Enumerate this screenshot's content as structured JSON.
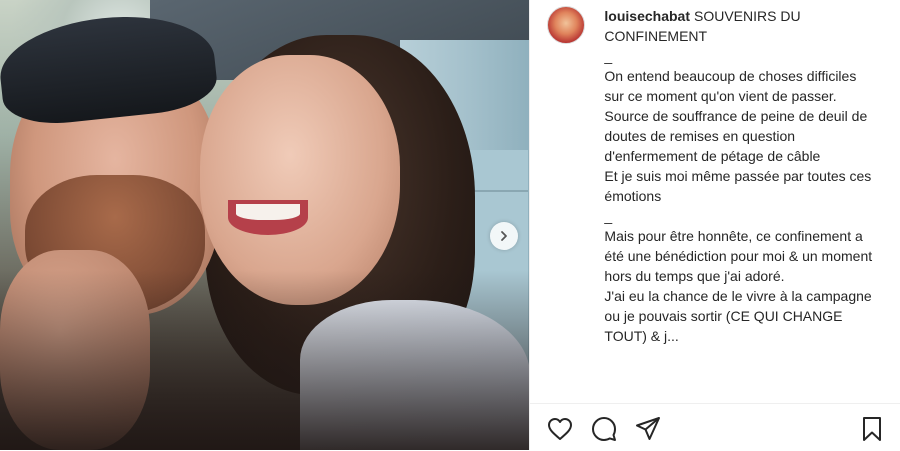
{
  "post": {
    "username": "louisechabat",
    "caption_title": "SOUVENIRS DU CONFINEMENT",
    "caption_lines": [
      "_",
      "On entend beaucoup de choses difficiles sur ce moment qu'on vient de passer.",
      "Source de souffrance de peine de deuil de doutes de remises en question d'enfermement de pétage de câble",
      "Et je suis moi même passée par toutes ces émotions",
      "",
      "_",
      "Mais pour être honnête, ce confinement a été une bénédiction pour moi & un moment hors du temps que j'ai adoré.",
      "J'ai eu la chance de le vivre à la campagne ou je pouvais sortir (CE QUI CHANGE TOUT) & j..."
    ]
  },
  "icons": {
    "next": "chevron-right-icon",
    "like": "heart-icon",
    "comment": "comment-icon",
    "share": "paper-plane-icon",
    "save": "bookmark-icon"
  },
  "colors": {
    "text": "#262626",
    "border": "#efefef"
  }
}
